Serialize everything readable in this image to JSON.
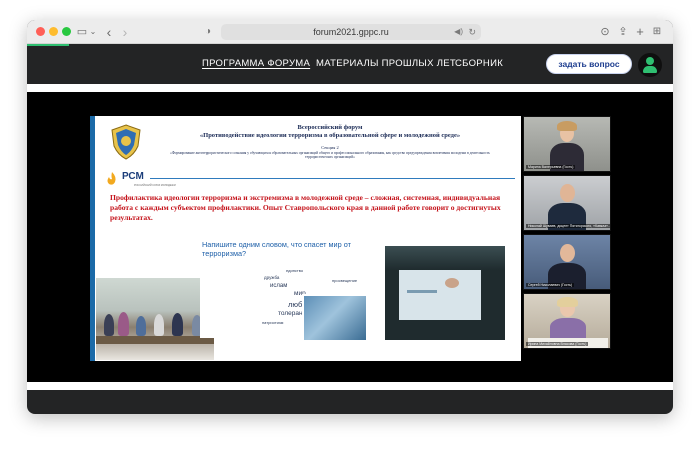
{
  "browser": {
    "url": "forum2021.gppc.ru"
  },
  "site_nav": {
    "items": [
      {
        "label": "ПРОГРАММА ФОРУМА",
        "active": true
      },
      {
        "label": "МАТЕРИАЛЫ ПРОШЛЫХ ЛЕТ",
        "active": false
      },
      {
        "label": "СБОРНИК",
        "active": false
      }
    ],
    "ask_button": "задать вопрос",
    "accent_color": "#2fbf71"
  },
  "slide": {
    "header_line1": "Всероссийский форум",
    "header_line2": "«Противодействие идеологии терроризма в образовательной сфере и молодежной среде»",
    "section": "Секция 2",
    "section_desc": "«Формирование антитеррористического сознания у обучающихся образовательных организаций общего и профессионального образования, как средство предупреждения вовлечения молодежи в деятельность террористических организаций»",
    "logo_text": "РСМ",
    "logo_sub": "РОССИЙСКИЙ СОЮЗ МОЛОДЕЖИ",
    "main_text": "Профилактика идеологии терроризма и экстремизма в молодежной среде – сложная, системная, индивидуальная работа с каждым субъектом профилактики. Опыт Ставропольского края в данной работе говорит о достигнутых результатах.",
    "wordcloud_title": "Напишите одним словом, что спасет мир от терроризма?",
    "wordcloud_words": [
      "мир",
      "любовь",
      "толерантность",
      "ислам",
      "единство",
      "дружба",
      "просвещение",
      "образование",
      "патриотизм"
    ]
  },
  "participants": [
    {
      "name": "Марина Валерьевна (Гость)"
    },
    {
      "name": "Николай Шуваев, доцент Пятигорского, «Кавказ»..."
    },
    {
      "name": "Сергей Николаевич (Гость)"
    },
    {
      "name": "Ирина Михайловна Власова (Гость)"
    }
  ]
}
